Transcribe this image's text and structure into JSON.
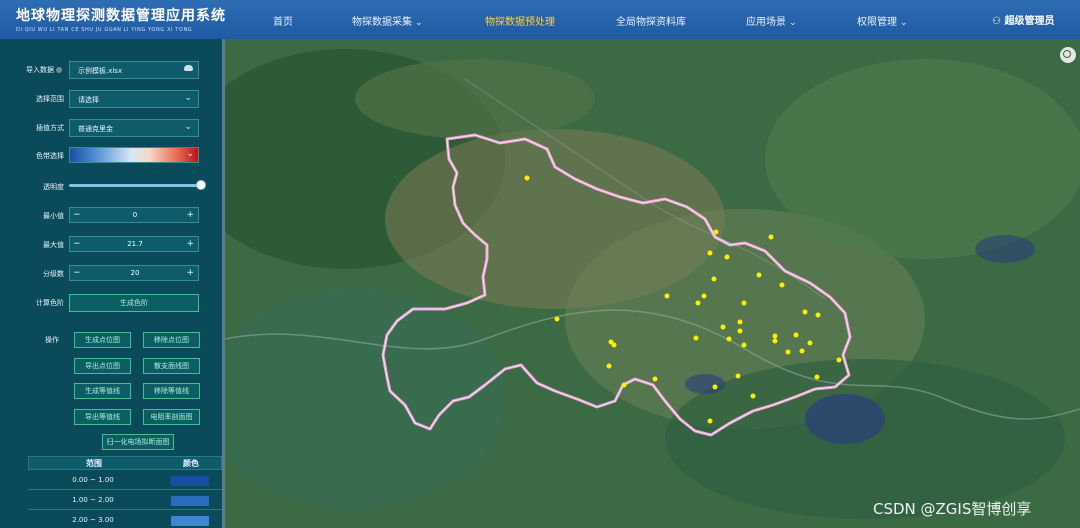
{
  "header": {
    "title": "地球物理探测数据管理应用系统",
    "subtitle": "DI QIU WU LI TAN CE SHU JU GUAN LI YING YONG XI TONG",
    "nav": [
      {
        "label": "首页",
        "has_dropdown": false
      },
      {
        "label": "物探数据采集",
        "has_dropdown": true
      },
      {
        "label": "物探数据预处理",
        "has_dropdown": false,
        "active": true
      },
      {
        "label": "全局物探资料库",
        "has_dropdown": false
      },
      {
        "label": "应用场景",
        "has_dropdown": true
      },
      {
        "label": "权限管理",
        "has_dropdown": true
      }
    ],
    "user": "超级管理员"
  },
  "sidebar": {
    "import_label": "导入数据",
    "import_file": "示例模板.xlsx",
    "range_label": "选择范围",
    "range_placeholder": "请选择",
    "interp_label": "插值方式",
    "interp_value": "普通克里金",
    "colorbar_label": "色带选择",
    "opacity_label": "透明度",
    "opacity_value": 1.0,
    "min_label": "最小值",
    "min_value": "0",
    "max_label": "最大值",
    "max_value": "21.7",
    "levels_label": "分级数",
    "levels_value": "20",
    "calc_label": "计算色阶",
    "calc_button": "生成色阶",
    "ops_label": "操作",
    "buttons": [
      "生成点位图",
      "移除点位图",
      "导出点位图",
      "散支面线图",
      "生成等值线",
      "移除等值线",
      "导出等值线",
      "电阻率剖面图"
    ],
    "normalize_button": "归一化电场拟断面图",
    "legend": {
      "head_range": "范围",
      "head_color": "颜色",
      "rows": [
        {
          "range": "0.00 ~ 1.00",
          "color": "#1a4fa0"
        },
        {
          "range": "1.00 ~ 2.00",
          "color": "#2a6cc0"
        },
        {
          "range": "2.00 ~ 3.00",
          "color": "#3e86cf"
        }
      ]
    }
  },
  "colors": {
    "header_bg": "#2563aa",
    "sidebar_bg": "#0b4a5a",
    "active_nav": "#ffd23a",
    "boundary": "#f0a8d8",
    "points": "#ffee00"
  },
  "map": {
    "watermark": "CSDN @ZGIS智博创享",
    "search_icon": "search-icon"
  }
}
